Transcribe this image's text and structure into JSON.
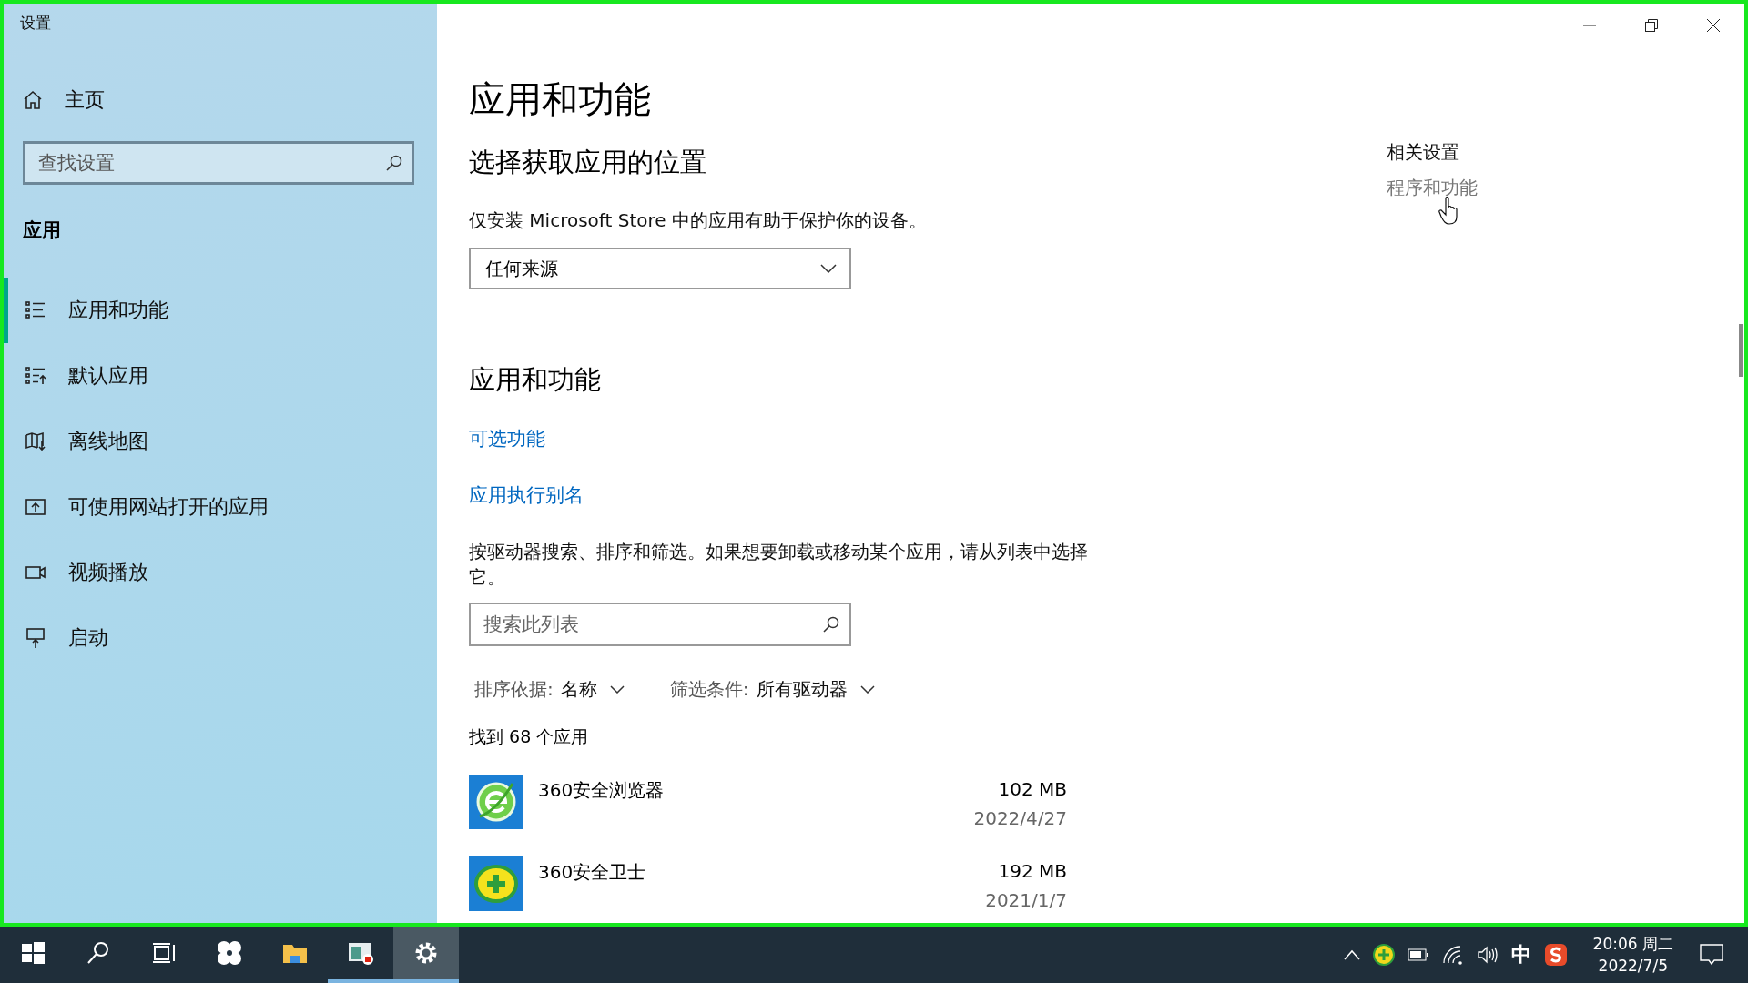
{
  "window": {
    "title": "设置"
  },
  "sidebar": {
    "home": "主页",
    "search": {
      "placeholder": "查找设置"
    },
    "section": "应用",
    "items": [
      {
        "label": "应用和功能",
        "kind": "list",
        "selected": true
      },
      {
        "label": "默认应用",
        "kind": "default",
        "selected": false
      },
      {
        "label": "离线地图",
        "kind": "map",
        "selected": false
      },
      {
        "label": "可使用网站打开的应用",
        "kind": "web",
        "selected": false
      },
      {
        "label": "视频播放",
        "kind": "video",
        "selected": false
      },
      {
        "label": "启动",
        "kind": "startup",
        "selected": false
      }
    ]
  },
  "main": {
    "title": "应用和功能",
    "source_heading": "选择获取应用的位置",
    "source_text": "仅安装 Microsoft Store 中的应用有助于保护你的设备。",
    "source_dropdown": "任何来源",
    "apps_heading": "应用和功能",
    "links": [
      "可选功能",
      "应用执行别名"
    ],
    "description": "按驱动器搜索、排序和筛选。如果想要卸载或移动某个应用，请从列表中选择它。",
    "list_search": {
      "placeholder": "搜索此列表"
    },
    "sort_label": "排序依据:",
    "sort_value": "名称",
    "filter_label": "筛选条件:",
    "filter_value": "所有驱动器",
    "count": "找到 68 个应用",
    "apps": [
      {
        "name": "360安全浏览器",
        "size": "102 MB",
        "date": "2022/4/27",
        "kind": "browser"
      },
      {
        "name": "360安全卫士",
        "size": "192 MB",
        "date": "2021/1/7",
        "kind": "guard"
      }
    ]
  },
  "related": {
    "heading": "相关设置",
    "link": "程序和功能"
  },
  "taskbar": {
    "apps": [
      {
        "kind": "start",
        "running": false,
        "selected": false
      },
      {
        "kind": "search",
        "running": false,
        "selected": false
      },
      {
        "kind": "taskview",
        "running": false,
        "selected": false
      },
      {
        "kind": "fan",
        "running": false,
        "selected": false
      },
      {
        "kind": "folder",
        "running": false,
        "selected": false
      },
      {
        "kind": "recorder",
        "running": true,
        "selected": false
      },
      {
        "kind": "gear",
        "running": true,
        "selected": true
      }
    ],
    "ime": "中",
    "time": "20:06 周二",
    "date": "2022/7/5"
  }
}
